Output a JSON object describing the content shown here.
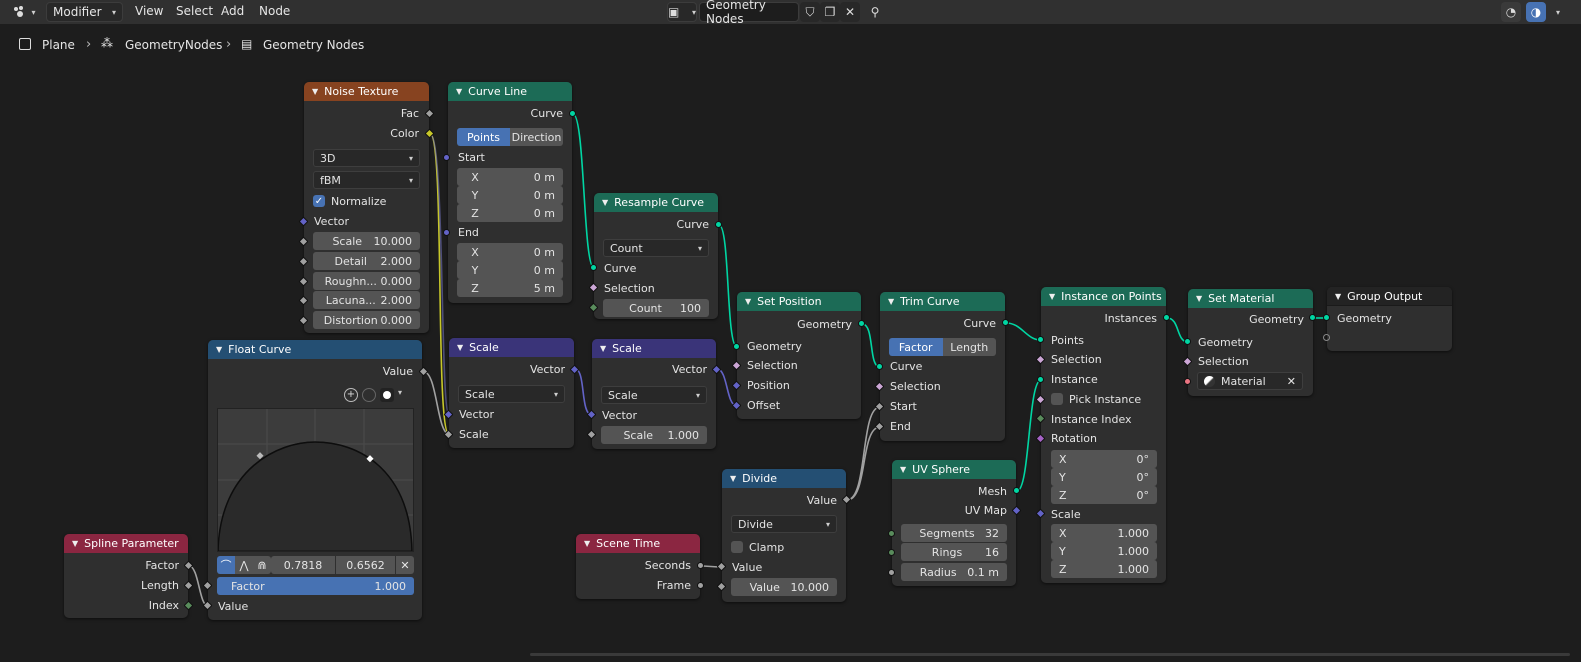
{
  "header": {
    "editor_mode": "Modifier",
    "menus": [
      "View",
      "Select",
      "Add",
      "Node"
    ],
    "node_tree_name": "Geometry Nodes"
  },
  "breadcrumb": [
    "Plane",
    "GeometryNodes",
    "Geometry Nodes"
  ],
  "nodes": {
    "noise_texture": {
      "title": "Noise Texture",
      "out_fac": "Fac",
      "out_color": "Color",
      "dimensions": "3D",
      "type": "fBM",
      "normalize": "Normalize",
      "in_vector": "Vector",
      "fields": [
        {
          "label": "Scale",
          "value": "10.000"
        },
        {
          "label": "Detail",
          "value": "2.000"
        },
        {
          "label": "Roughn...",
          "value": "0.000"
        },
        {
          "label": "Lacuna...",
          "value": "2.000"
        },
        {
          "label": "Distortion",
          "value": "0.000"
        }
      ]
    },
    "curve_line": {
      "title": "Curve Line",
      "out_curve": "Curve",
      "mode_points": "Points",
      "mode_direction": "Direction",
      "start": "Start",
      "end": "End",
      "start_xyz": [
        {
          "a": "X",
          "v": "0 m"
        },
        {
          "a": "Y",
          "v": "0 m"
        },
        {
          "a": "Z",
          "v": "0 m"
        }
      ],
      "end_xyz": [
        {
          "a": "X",
          "v": "0 m"
        },
        {
          "a": "Y",
          "v": "0 m"
        },
        {
          "a": "Z",
          "v": "5 m"
        }
      ]
    },
    "resample_curve": {
      "title": "Resample Curve",
      "out_curve": "Curve",
      "mode": "Count",
      "in_curve": "Curve",
      "in_selection": "Selection",
      "count_label": "Count",
      "count_value": "100"
    },
    "set_position": {
      "title": "Set Position",
      "out_geometry": "Geometry",
      "in_geometry": "Geometry",
      "in_selection": "Selection",
      "in_position": "Position",
      "in_offset": "Offset"
    },
    "trim_curve": {
      "title": "Trim Curve",
      "out_curve": "Curve",
      "mode_factor": "Factor",
      "mode_length": "Length",
      "in_curve": "Curve",
      "in_selection": "Selection",
      "in_start": "Start",
      "in_end": "End"
    },
    "instance_on_points": {
      "title": "Instance on Points",
      "out_instances": "Instances",
      "in_points": "Points",
      "in_selection": "Selection",
      "in_instance": "Instance",
      "pick_instance": "Pick Instance",
      "in_instance_index": "Instance Index",
      "in_rotation": "Rotation",
      "rotation_xyz": [
        {
          "a": "X",
          "v": "0°"
        },
        {
          "a": "Y",
          "v": "0°"
        },
        {
          "a": "Z",
          "v": "0°"
        }
      ],
      "in_scale": "Scale",
      "scale_xyz": [
        {
          "a": "X",
          "v": "1.000"
        },
        {
          "a": "Y",
          "v": "1.000"
        },
        {
          "a": "Z",
          "v": "1.000"
        }
      ]
    },
    "set_material": {
      "title": "Set Material",
      "in_geometry": "Geometry",
      "in_selection": "Selection",
      "material": "Material"
    },
    "group_output": {
      "title": "Group Output",
      "out_geometry": "Geometry",
      "in_geometry": "Geometry"
    },
    "float_curve": {
      "title": "Float Curve",
      "out_value": "Value",
      "point_x": "0.7818",
      "point_y": "0.6562",
      "factor_label": "Factor",
      "factor_value": "1.000",
      "in_value": "Value"
    },
    "scale_1": {
      "title": "Scale",
      "out_vector": "Vector",
      "op": "Scale",
      "in_vector": "Vector",
      "in_scale": "Scale"
    },
    "scale_2": {
      "title": "Scale",
      "out_vector": "Vector",
      "op": "Scale",
      "in_vector": "Vector",
      "scale_label": "Scale",
      "scale_value": "1.000"
    },
    "divide": {
      "title": "Divide",
      "out_value": "Value",
      "op": "Divide",
      "clamp": "Clamp",
      "in_value": "Value",
      "value_label": "Value",
      "value_value": "10.000"
    },
    "uv_sphere": {
      "title": "UV Sphere",
      "out_mesh": "Mesh",
      "out_uvmap": "UV Map",
      "fields": [
        {
          "label": "Segments",
          "value": "32"
        },
        {
          "label": "Rings",
          "value": "16"
        },
        {
          "label": "Radius",
          "value": "0.1 m"
        }
      ]
    },
    "scene_time": {
      "title": "Scene Time",
      "out_seconds": "Seconds",
      "out_frame": "Frame"
    },
    "spline_parameter": {
      "title": "Spline Parameter",
      "out_factor": "Factor",
      "out_length": "Length",
      "out_index": "Index"
    }
  },
  "colors": {
    "geometry_socket": "#00d6a3",
    "vector_socket": "#6363c7",
    "float_socket": "#a1a1a1",
    "color_socket": "#c7c729",
    "int_socket": "#598c5c",
    "accent": "#4772b3"
  }
}
